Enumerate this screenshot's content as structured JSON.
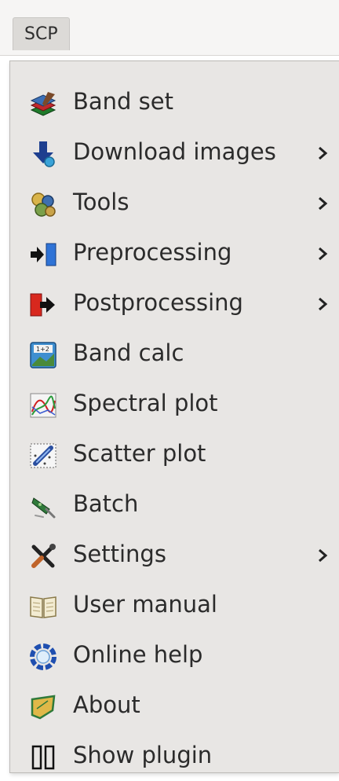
{
  "menubar": {
    "title": "SCP"
  },
  "menu": {
    "items": [
      {
        "label": "Band set",
        "icon": "band-set-icon",
        "submenu": false
      },
      {
        "label": "Download images",
        "icon": "download-icon",
        "submenu": true
      },
      {
        "label": "Tools",
        "icon": "tools-icon",
        "submenu": true
      },
      {
        "label": "Preprocessing",
        "icon": "preprocessing-icon",
        "submenu": true
      },
      {
        "label": "Postprocessing",
        "icon": "postprocessing-icon",
        "submenu": true
      },
      {
        "label": "Band calc",
        "icon": "band-calc-icon",
        "submenu": false
      },
      {
        "label": "Spectral plot",
        "icon": "spectral-plot-icon",
        "submenu": false
      },
      {
        "label": "Scatter plot",
        "icon": "scatter-plot-icon",
        "submenu": false
      },
      {
        "label": "Batch",
        "icon": "batch-icon",
        "submenu": false
      },
      {
        "label": "Settings",
        "icon": "settings-icon",
        "submenu": true
      },
      {
        "label": "User manual",
        "icon": "user-manual-icon",
        "submenu": false
      },
      {
        "label": "Online help",
        "icon": "online-help-icon",
        "submenu": false
      },
      {
        "label": "About",
        "icon": "about-icon",
        "submenu": false
      },
      {
        "label": "Show plugin",
        "icon": "show-plugin-icon",
        "submenu": false
      }
    ]
  },
  "colors": {
    "menu_background": "#e8e6e4",
    "menubar_background": "#f6f5f4",
    "text": "#2b2b2b"
  }
}
